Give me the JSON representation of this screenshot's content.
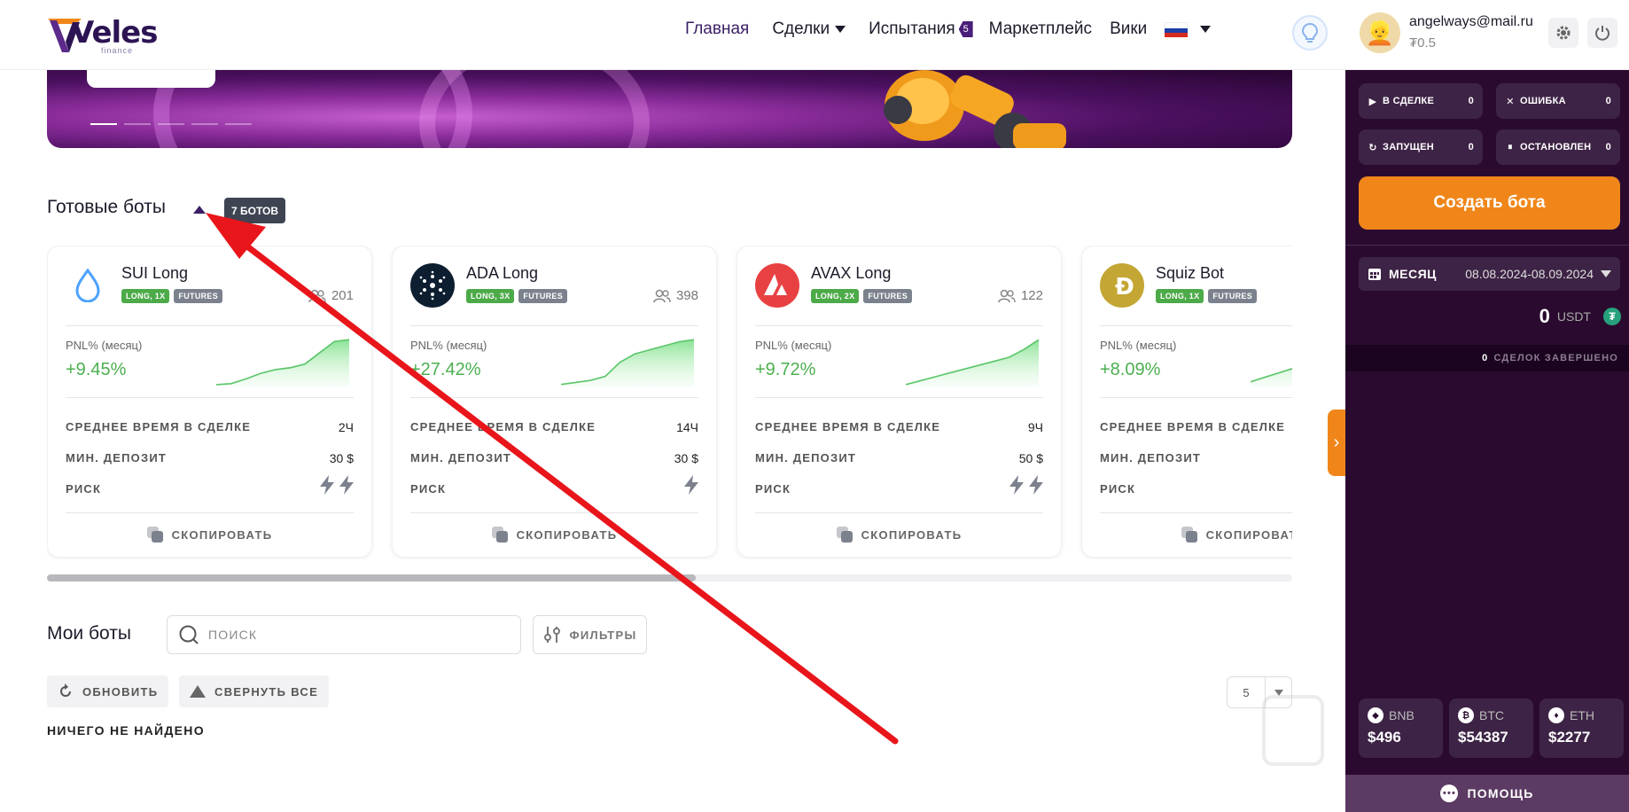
{
  "header": {
    "logo": "Veles",
    "logo_sub": "finance",
    "nav": [
      {
        "label": "Главная"
      },
      {
        "label": "Сделки"
      },
      {
        "label": "Испытания",
        "badge": "5"
      },
      {
        "label": "Маркетплейс"
      },
      {
        "label": "Вики"
      }
    ]
  },
  "ready_bots": {
    "title": "Готовые боты",
    "count": "7 БОТОВ",
    "pnl_label": "PNL% (месяц)",
    "row_labels": {
      "avg_time": "СРЕДНЕЕ ВРЕМЯ В СДЕЛКЕ",
      "min_deposit": "МИН. ДЕПОЗИТ",
      "risk": "РИСК"
    },
    "copy_label": "СКОПИРОВАТЬ",
    "cards": [
      {
        "name": "SUI Long",
        "tag1": "LONG, 1X",
        "tag2": "FUTURES",
        "users": "201",
        "pnl": "+9.45%",
        "avg_time": "2Ч",
        "min_deposit": "30 $",
        "risk": 2,
        "icon": "sui-drop-icon",
        "spark": [
          2,
          3,
          8,
          14,
          18,
          20,
          24,
          36,
          48,
          50
        ]
      },
      {
        "name": "ADA Long",
        "tag1": "LONG, 3X",
        "tag2": "FUTURES",
        "users": "398",
        "pnl": "+27.42%",
        "avg_time": "14Ч",
        "min_deposit": "30 $",
        "risk": 1,
        "icon": "cardano-icon",
        "spark": [
          2,
          4,
          6,
          10,
          24,
          32,
          36,
          40,
          44,
          46
        ]
      },
      {
        "name": "AVAX Long",
        "tag1": "LONG, 2X",
        "tag2": "FUTURES",
        "users": "122",
        "pnl": "+9.72%",
        "avg_time": "9Ч",
        "min_deposit": "50 $",
        "risk": 2,
        "icon": "avalanche-icon",
        "spark": [
          2,
          6,
          10,
          14,
          18,
          22,
          26,
          30,
          38,
          48
        ]
      },
      {
        "name": "Squiz Bot",
        "tag1": "LONG, 1X",
        "tag2": "FUTURES",
        "users": "",
        "pnl": "+8.09%",
        "avg_time": "",
        "min_deposit": "",
        "risk": 0,
        "icon": "dogecoin-icon",
        "spark": [
          2,
          4,
          6,
          8,
          10,
          12,
          14,
          16,
          18,
          20
        ]
      }
    ]
  },
  "my_bots": {
    "title": "Мои боты",
    "search_placeholder": "ПОИСК",
    "filters_label": "ФИЛЬТРЫ",
    "refresh_label": "ОБНОВИТЬ",
    "collapse_label": "СВЕРНУТЬ ВСЕ",
    "empty": "НИЧЕГО НЕ НАЙДЕНО",
    "per_page": "5"
  },
  "sidebar": {
    "email": "angelways@mail.ru",
    "balance": "₮0.5",
    "stats": [
      {
        "label": "В СДЕЛКЕ",
        "value": "0",
        "icon": "play-icon"
      },
      {
        "label": "ОШИБКА",
        "value": "0",
        "icon": "close-icon"
      },
      {
        "label": "ЗАПУЩЕН",
        "value": "0",
        "icon": "refresh-icon"
      },
      {
        "label": "ОСТАНОВЛЕН",
        "value": "0",
        "icon": "pause-icon"
      }
    ],
    "create_label": "Создать бота",
    "period_label": "МЕСЯЦ",
    "period_range": "08.08.2024-08.09.2024",
    "total_value": "0",
    "total_currency": "USDT",
    "deals_count": "0",
    "deals_label": "СДЕЛОК ЗАВЕРШЕНО",
    "coins": [
      {
        "symbol": "BNB",
        "price": "$496"
      },
      {
        "symbol": "BTC",
        "price": "$54387"
      },
      {
        "symbol": "ETH",
        "price": "$2277"
      }
    ],
    "help_label": "ПОМОЩЬ"
  },
  "colors": {
    "accent": "#f0861a",
    "sidebar": "#2a0b2f",
    "positive": "#4caf50",
    "arrow": "#e8151b"
  }
}
